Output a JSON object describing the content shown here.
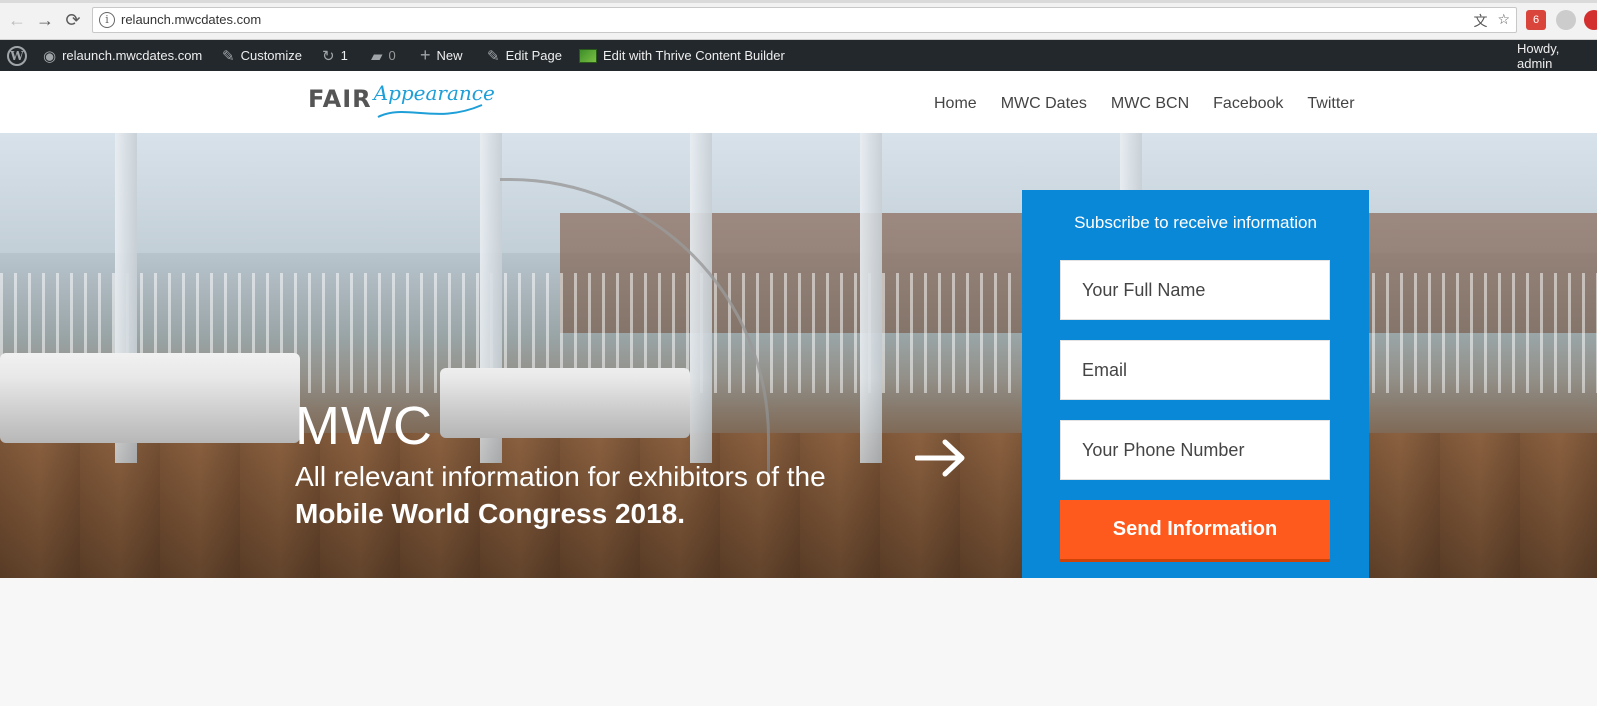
{
  "browser": {
    "url": "relaunch.mwcdates.com",
    "gmail_badge": "6"
  },
  "admin_bar": {
    "site": "relaunch.mwcdates.com",
    "customize": "Customize",
    "updates_count": "1",
    "comments_count": "0",
    "new": "New",
    "edit_page": "Edit Page",
    "thrive": "Edit with Thrive Content Builder",
    "howdy": "Howdy, admin"
  },
  "site": {
    "logo_fair": "FAIR",
    "logo_appearance": "Appearance",
    "menu": [
      "Home",
      "MWC Dates",
      "MWC BCN",
      "Facebook",
      "Twitter"
    ]
  },
  "hero": {
    "title": "MWC",
    "subtitle_line1": "All relevant information for exhibitors of the",
    "subtitle_line2": "Mobile World Congress 2018."
  },
  "subscribe": {
    "title": "Subscribe to receive information",
    "name_placeholder": "Your Full Name",
    "email_placeholder": "Email",
    "phone_placeholder": "Your Phone Number",
    "button": "Send Information",
    "bg_color": "#0a88d8",
    "button_color": "#fe5a1d"
  }
}
